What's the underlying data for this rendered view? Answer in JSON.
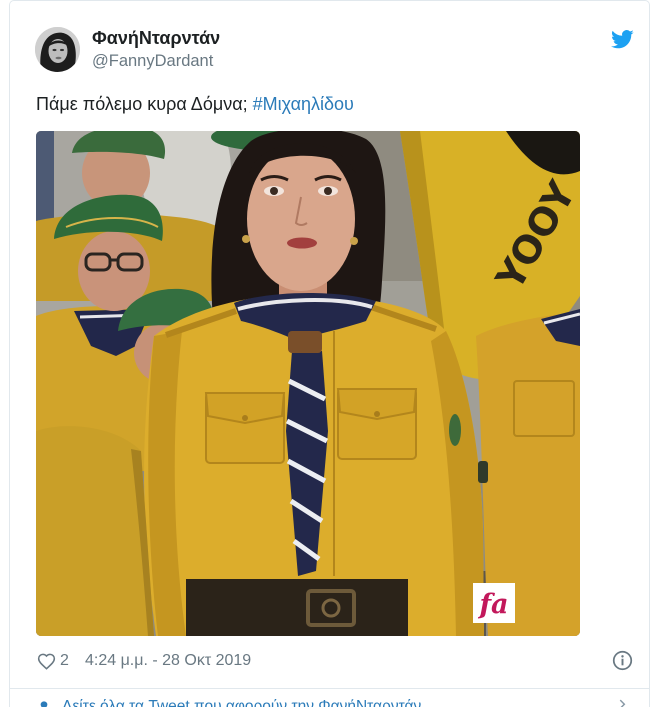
{
  "tweet": {
    "author": {
      "display_name": "ΦανήΝταρντάν",
      "handle": "@FannyDardant"
    },
    "text": "Πάμε πόλεμο κυρα Δόμνα;",
    "hashtag": "#Μιχαηλίδου",
    "likes": "2",
    "timestamp": "4:24 μ.μ. - 28 Οκτ 2019"
  },
  "media": {
    "flag_text": "YOOY",
    "watermark": "fa"
  },
  "footer": {
    "more_tweets_label": "Δείτε όλα τα Tweet που αφορούν την ΦανήΝταρντάν"
  },
  "icons": {
    "brand": "twitter-bird-icon",
    "like": "heart-icon",
    "info": "info-icon",
    "more": "chevron-right-icon",
    "profile": "user-icon"
  },
  "colors": {
    "text": "#1c2022",
    "muted": "#697882",
    "link": "#2b7bb9",
    "brand": "#1da1f2",
    "divider": "#e1e8ed",
    "watermark": "#c2185b"
  }
}
